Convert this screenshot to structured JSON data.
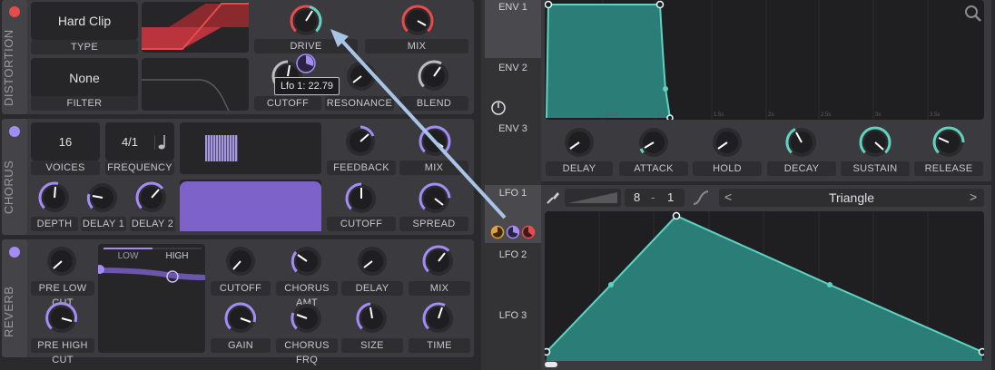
{
  "colors": {
    "red": "#e84b4b",
    "purple": "#a48cf5",
    "teal": "#5fd3c0",
    "dark": "#262628"
  },
  "distortion": {
    "section_label": "DISTORTION",
    "type_value": "Hard Clip",
    "type_label": "TYPE",
    "filter_value": "None",
    "filter_label": "FILTER",
    "drive_label": "DRIVE",
    "mix_label": "MIX",
    "cutoff_label": "CUTOFF",
    "resonance_label": "RESONANCE",
    "blend_label": "BLEND",
    "tooltip": "Lfo 1: 22.79"
  },
  "chorus": {
    "section_label": "CHORUS",
    "voices_value": "16",
    "voices_label": "VOICES",
    "frequency_value": "4/1",
    "frequency_label": "FREQUENCY",
    "feedback_label": "FEEDBACK",
    "mix_label": "MIX",
    "depth_label": "DEPTH",
    "delay1_label": "DELAY 1",
    "delay2_label": "DELAY 2",
    "cutoff_label": "CUTOFF",
    "spread_label": "SPREAD"
  },
  "reverb": {
    "section_label": "REVERB",
    "low_label": "LOW",
    "high_label": "HIGH",
    "pre_low_cut_label": "PRE LOW CUT",
    "pre_high_cut_label": "PRE HIGH CUT",
    "cutoff_label": "CUTOFF",
    "chorus_amt_label": "CHORUS AMT",
    "delay_label": "DELAY",
    "mix_label": "MIX",
    "gain_label": "GAIN",
    "chorus_frq_label": "CHORUS FRQ",
    "size_label": "SIZE",
    "time_label": "TIME"
  },
  "envelope": {
    "tabs": [
      "ENV 1",
      "ENV 2",
      "ENV 3"
    ],
    "knobs": [
      "DELAY",
      "ATTACK",
      "HOLD",
      "DECAY",
      "SUSTAIN",
      "RELEASE"
    ],
    "time_ticks": [
      "100m",
      "1s",
      "1.5s",
      "2s",
      "2.5s",
      "3s",
      "3.5s"
    ]
  },
  "lfo": {
    "tabs": [
      "LFO 1",
      "LFO 2",
      "LFO 3"
    ],
    "num_a": "8",
    "dash": "-",
    "num_b": "1",
    "shape": "Triangle",
    "prev": "<",
    "next": ">"
  }
}
